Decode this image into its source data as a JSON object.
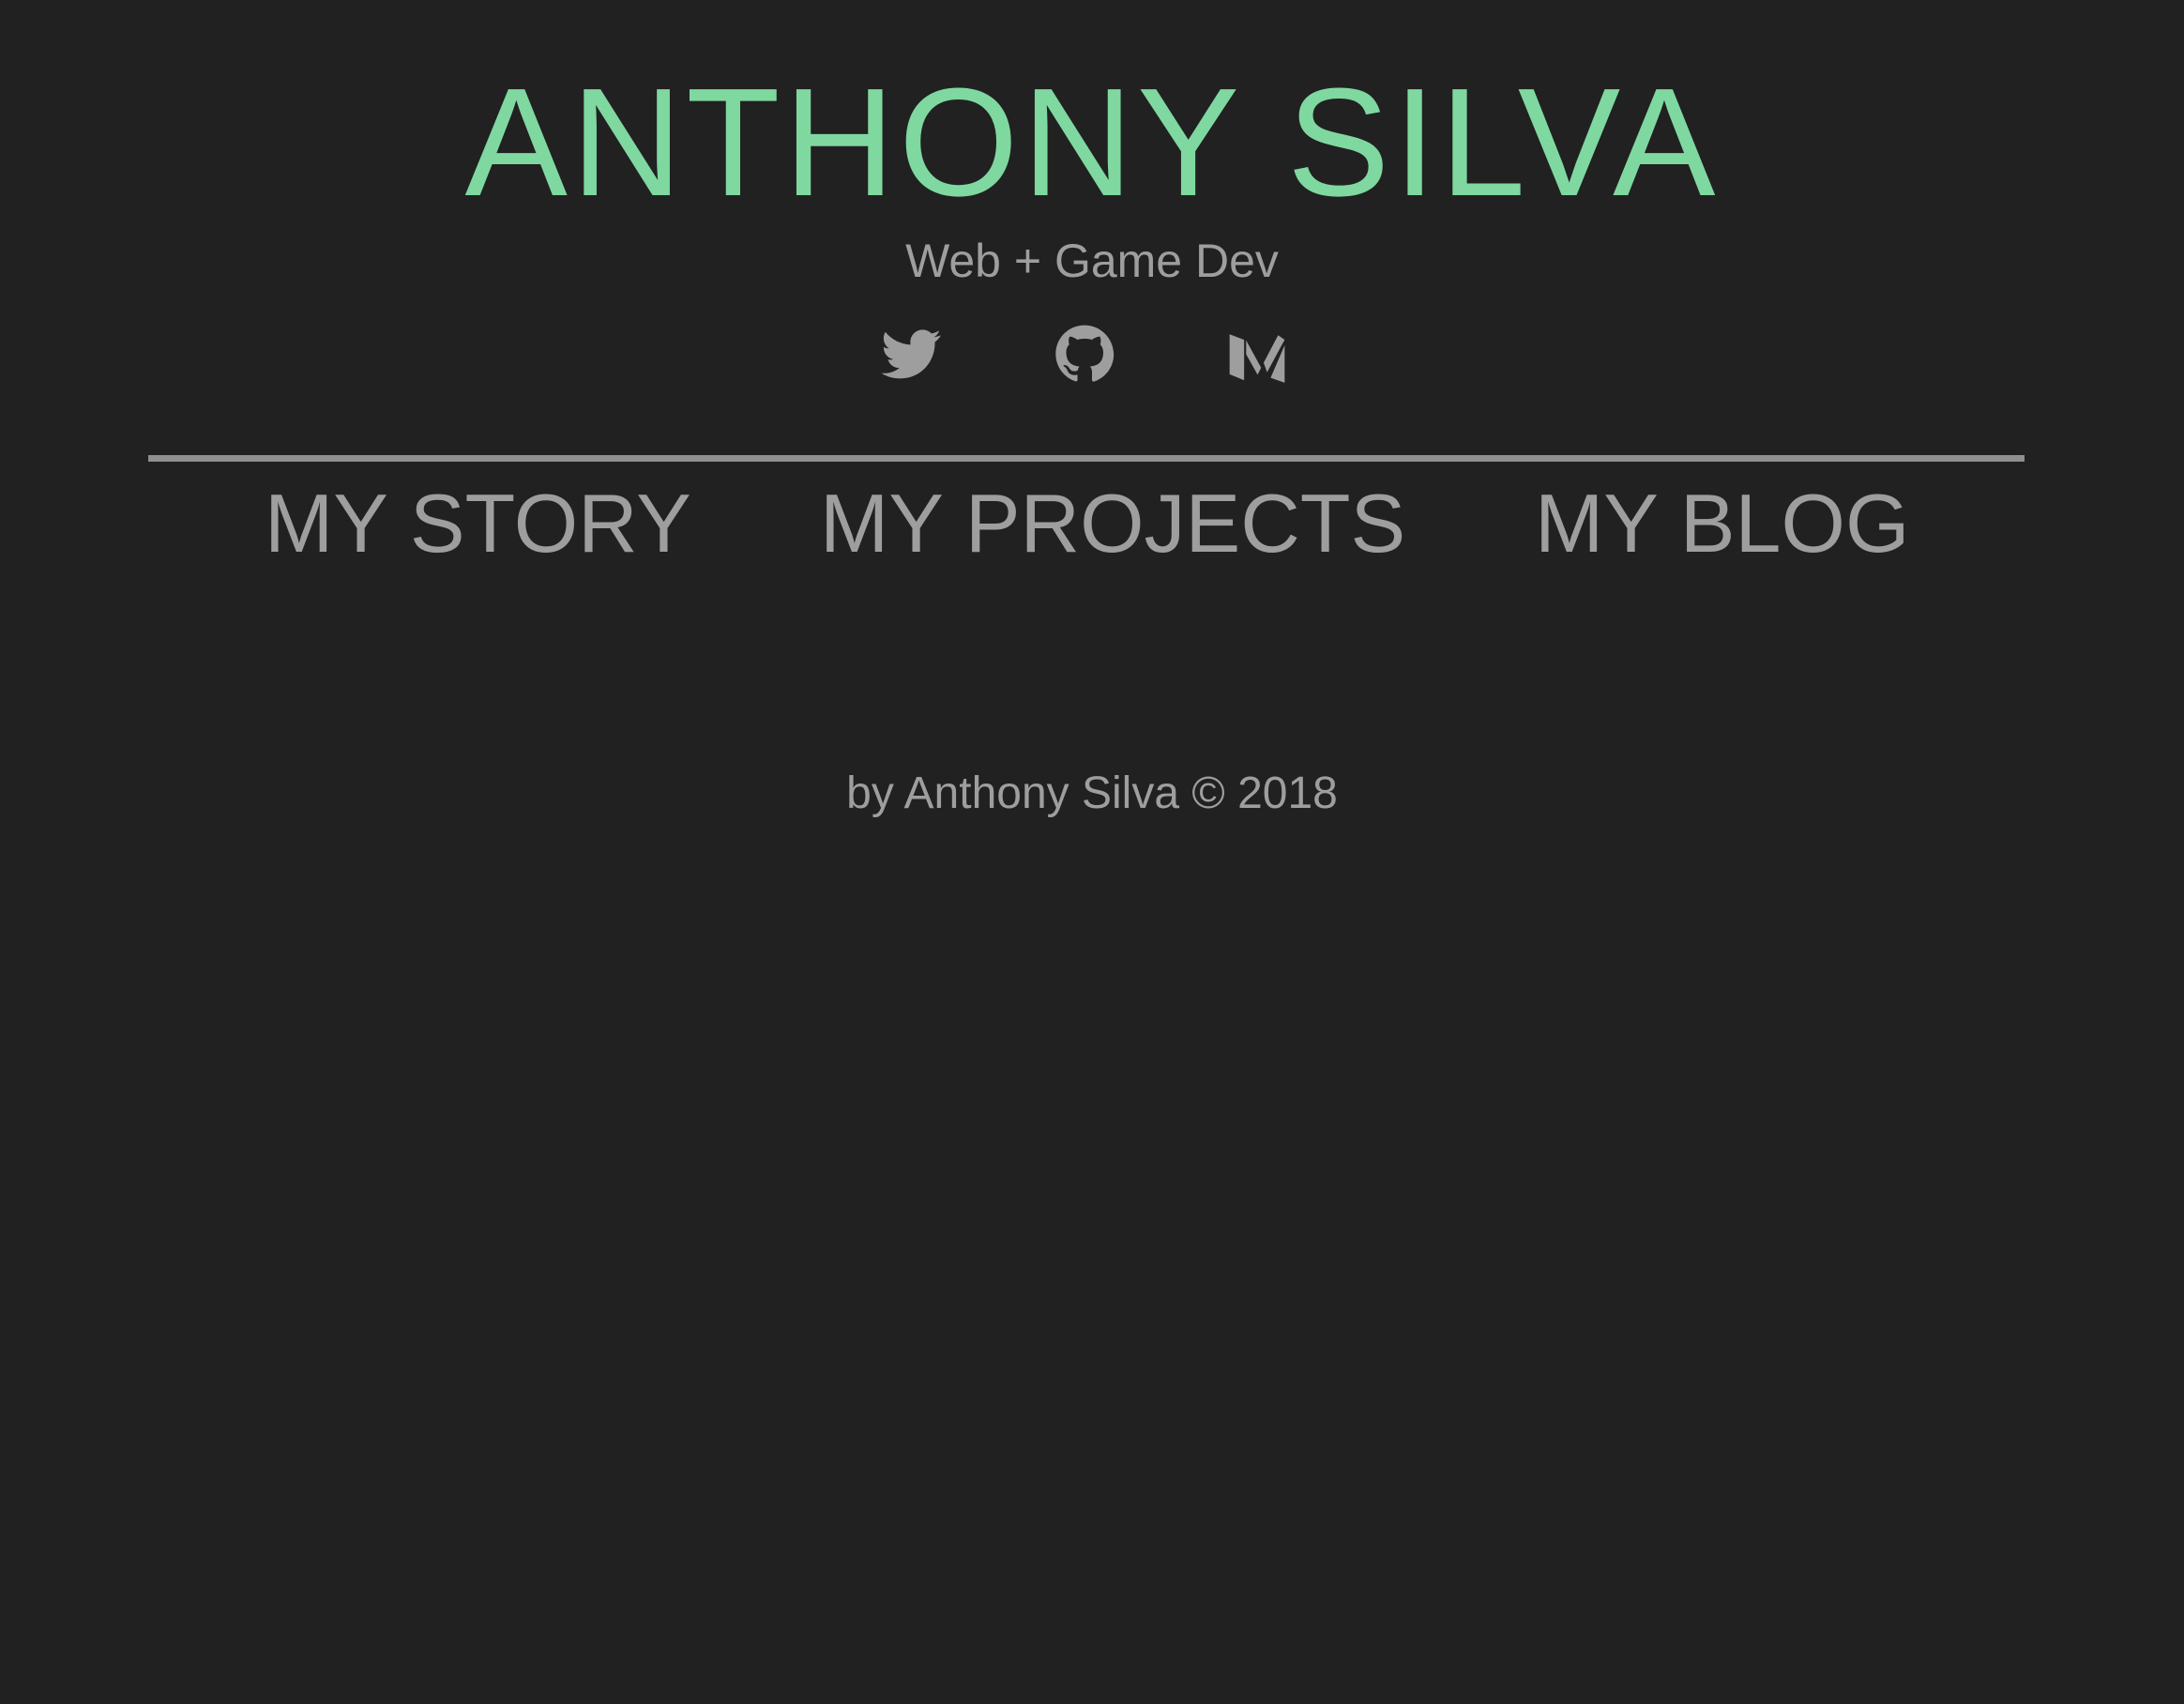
{
  "header": {
    "title": "ANTHONY SILVA",
    "tagline": "Web + Game Dev",
    "title_color": "#7fd8a0"
  },
  "social": [
    {
      "icon": "twitter-icon"
    },
    {
      "icon": "github-icon"
    },
    {
      "icon": "medium-icon"
    }
  ],
  "nav": {
    "story": "MY STORY",
    "projects": "MY PROJECTS",
    "blog": "MY BLOG"
  },
  "footer": {
    "text": "by Anthony Silva © 2018"
  },
  "colors": {
    "background": "#212121",
    "text_muted": "#9e9e9e",
    "divider": "#8f8f8f"
  }
}
